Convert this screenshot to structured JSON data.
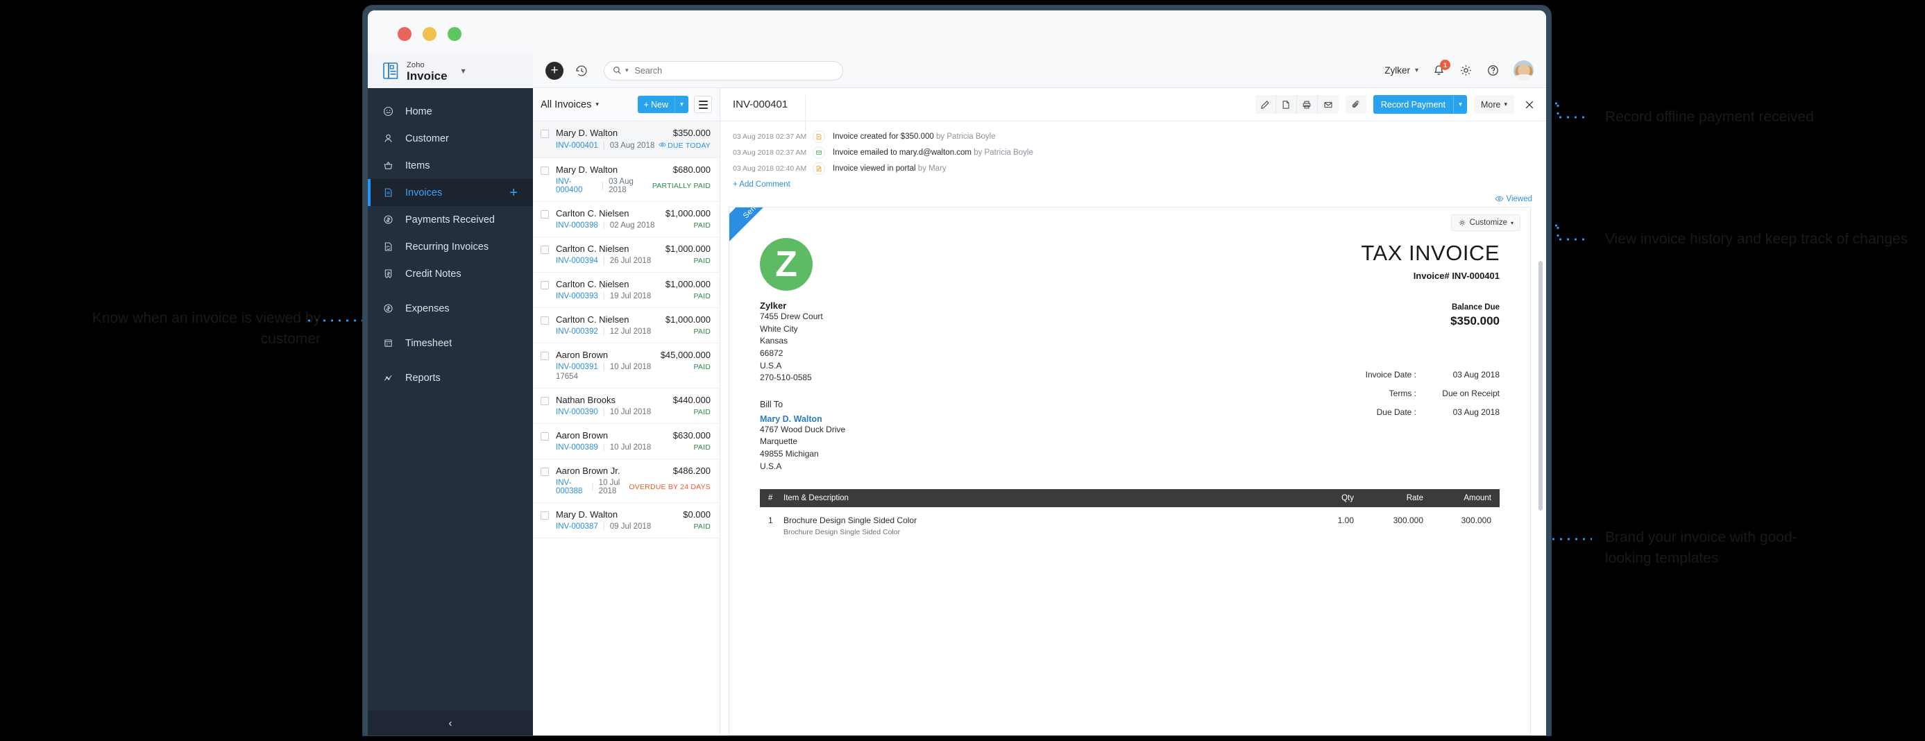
{
  "window": {
    "lights": [
      "close",
      "minimize",
      "maximize"
    ]
  },
  "brand": {
    "zoho": "Zoho",
    "name": "Invoice"
  },
  "sidebar": {
    "items": [
      {
        "label": "Home",
        "icon": "gauge-icon",
        "active": false,
        "plus": false
      },
      {
        "label": "Customer",
        "icon": "person-icon",
        "active": false,
        "plus": false
      },
      {
        "label": "Items",
        "icon": "basket-icon",
        "active": false,
        "plus": false
      },
      {
        "label": "Invoices",
        "icon": "document-icon",
        "active": true,
        "plus": true
      },
      {
        "label": "Payments Received",
        "icon": "payment-received-icon",
        "active": false,
        "plus": false
      },
      {
        "label": "Recurring Invoices",
        "icon": "recurring-icon",
        "active": false,
        "plus": false
      },
      {
        "label": "Credit Notes",
        "icon": "credit-note-icon",
        "active": false,
        "plus": false
      },
      {
        "label": "Expenses",
        "icon": "dollar-circle-icon",
        "active": false,
        "plus": false
      },
      {
        "label": "Timesheet",
        "icon": "timesheet-icon",
        "active": false,
        "plus": false
      },
      {
        "label": "Reports",
        "icon": "chart-icon",
        "active": false,
        "plus": false
      }
    ],
    "collapse_label": "‹"
  },
  "topbar": {
    "add_label": "+",
    "search_placeholder": "Search",
    "org_name": "Zylker",
    "notification_count": "1"
  },
  "list": {
    "filter_label": "All Invoices",
    "new_label": "New",
    "invoices": [
      {
        "name": "Mary D. Walton",
        "number": "INV-000401",
        "date": "03 Aug 2018",
        "amount": "$350.000",
        "status": "DUE TODAY",
        "status_type": "due",
        "viewed": true,
        "selected": true,
        "extra": ""
      },
      {
        "name": "Mary D. Walton",
        "number": "INV-000400",
        "date": "03 Aug 2018",
        "amount": "$680.000",
        "status": "PARTIALLY PAID",
        "status_type": "partial",
        "viewed": false,
        "selected": false,
        "extra": ""
      },
      {
        "name": "Carlton C. Nielsen",
        "number": "INV-000398",
        "date": "02 Aug 2018",
        "amount": "$1,000.000",
        "status": "PAID",
        "status_type": "paid",
        "viewed": false,
        "selected": false,
        "extra": ""
      },
      {
        "name": "Carlton C. Nielsen",
        "number": "INV-000394",
        "date": "26 Jul 2018",
        "amount": "$1,000.000",
        "status": "PAID",
        "status_type": "paid",
        "viewed": false,
        "selected": false,
        "extra": ""
      },
      {
        "name": "Carlton C. Nielsen",
        "number": "INV-000393",
        "date": "19 Jul 2018",
        "amount": "$1,000.000",
        "status": "PAID",
        "status_type": "paid",
        "viewed": false,
        "selected": false,
        "extra": ""
      },
      {
        "name": "Carlton C. Nielsen",
        "number": "INV-000392",
        "date": "12 Jul 2018",
        "amount": "$1,000.000",
        "status": "PAID",
        "status_type": "paid",
        "viewed": false,
        "selected": false,
        "extra": ""
      },
      {
        "name": "Aaron Brown",
        "number": "INV-000391",
        "date": "10 Jul 2018",
        "amount": "$45,000.000",
        "status": "PAID",
        "status_type": "paid",
        "viewed": false,
        "selected": false,
        "extra": "17654"
      },
      {
        "name": "Nathan Brooks",
        "number": "INV-000390",
        "date": "10 Jul 2018",
        "amount": "$440.000",
        "status": "PAID",
        "status_type": "paid",
        "viewed": false,
        "selected": false,
        "extra": ""
      },
      {
        "name": "Aaron Brown",
        "number": "INV-000389",
        "date": "10 Jul 2018",
        "amount": "$630.000",
        "status": "PAID",
        "status_type": "paid",
        "viewed": false,
        "selected": false,
        "extra": ""
      },
      {
        "name": "Aaron Brown Jr.",
        "number": "INV-000388",
        "date": "10 Jul 2018",
        "amount": "$486.200",
        "status": "OVERDUE BY 24 DAYS",
        "status_type": "overdue",
        "viewed": false,
        "selected": false,
        "extra": ""
      },
      {
        "name": "Mary D. Walton",
        "number": "INV-000387",
        "date": "09 Jul 2018",
        "amount": "$0.000",
        "status": "PAID",
        "status_type": "paid",
        "viewed": false,
        "selected": false,
        "extra": ""
      }
    ]
  },
  "detail": {
    "title": "INV-000401",
    "tools": [
      "edit-icon",
      "pdf-icon",
      "print-icon",
      "email-icon",
      "attachment-icon"
    ],
    "record_payment_label": "Record Payment",
    "more_label": "More",
    "timeline": [
      {
        "time": "03 Aug 2018 02:37 AM",
        "icon": "invoice-created-icon",
        "text": "Invoice created for $350.000",
        "by": "by Patricia Boyle"
      },
      {
        "time": "03 Aug 2018 02:37 AM",
        "icon": "email-sent-icon",
        "text": "Invoice emailed to mary.d@walton.com",
        "by": "by Patricia Boyle"
      },
      {
        "time": "03 Aug 2018 02:40 AM",
        "icon": "invoice-viewed-icon",
        "text": "Invoice viewed in portal",
        "by": "by Mary"
      }
    ],
    "add_comment_label": "+ Add Comment",
    "viewed_label": "Viewed"
  },
  "document": {
    "ribbon_label": "Sent",
    "customize_label": "Customize",
    "logo_letter": "Z",
    "heading": "TAX INVOICE",
    "invoice_no_label": "Invoice# INV-000401",
    "balance_due_label": "Balance Due",
    "balance_due_amount": "$350.000",
    "from": {
      "name": "Zylker",
      "lines": [
        "7455 Drew Court",
        "White City",
        "Kansas",
        "66872",
        "U.S.A",
        "270-510-0585"
      ]
    },
    "bill_to_label": "Bill To",
    "bill_to": {
      "name": "Mary D. Walton",
      "lines": [
        "4767 Wood Duck Drive",
        "Marquette",
        "49855 Michigan",
        "U.S.A"
      ]
    },
    "meta": [
      {
        "key": "Invoice Date :",
        "value": "03 Aug 2018"
      },
      {
        "key": "Terms :",
        "value": "Due on Receipt"
      },
      {
        "key": "Due Date :",
        "value": "03 Aug 2018"
      }
    ],
    "items_header": {
      "num": "#",
      "desc": "Item & Description",
      "qty": "Qty",
      "rate": "Rate",
      "amount": "Amount"
    },
    "items": [
      {
        "num": "1",
        "desc": "Brochure Design Single Sided Color",
        "sub": "Brochure Design Single Sided Color",
        "qty": "1.00",
        "rate": "300.000",
        "amount": "300.000"
      }
    ]
  },
  "annotations": [
    {
      "id": "record-payment",
      "text": "Record offline payment received"
    },
    {
      "id": "invoice-history",
      "text": "View invoice history and keep track of changes"
    },
    {
      "id": "brand-invoice",
      "text": "Brand your invoice with good-looking templates"
    },
    {
      "id": "invoice-viewed",
      "text": "Know when an invoice is viewed by customer"
    }
  ],
  "colors": {
    "accent_blue": "#2aa3ef",
    "sidebar_dark": "#242f3d",
    "paid_green": "#2e8b45",
    "overdue_orange": "#f05a28",
    "logo_green": "#5dbb63",
    "marker_red": "#e8231e"
  }
}
